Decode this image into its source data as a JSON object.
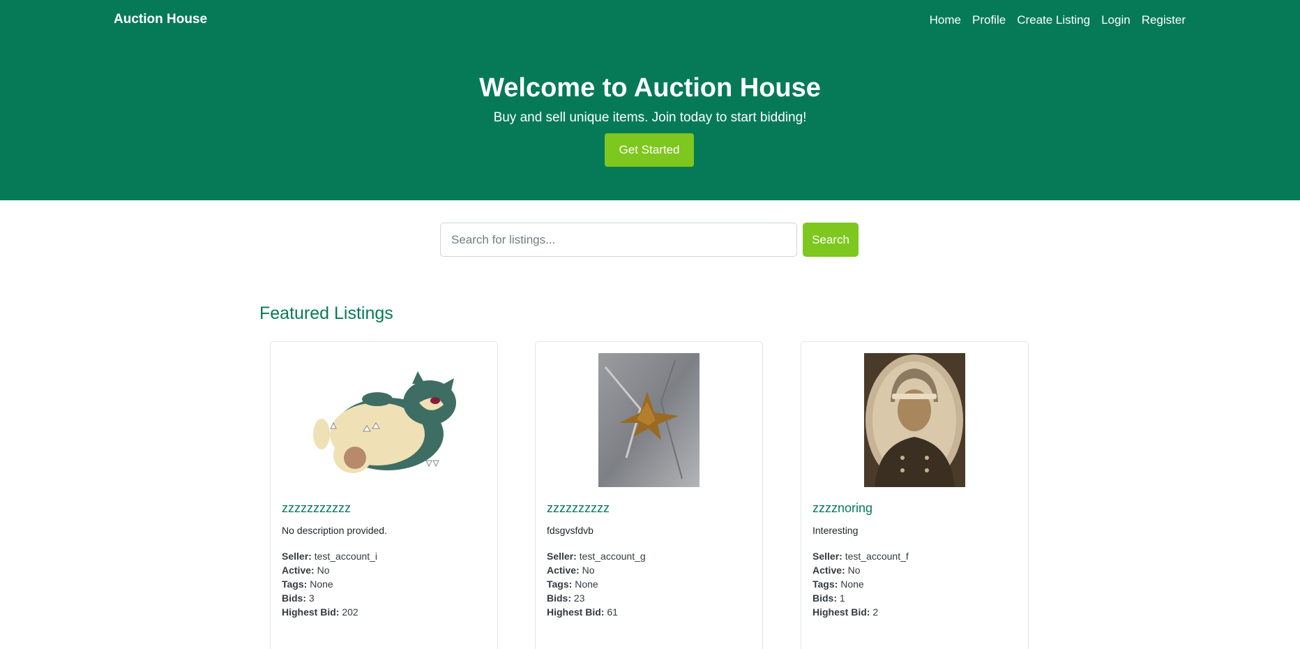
{
  "nav": {
    "brand": "Auction House",
    "links": [
      "Home",
      "Profile",
      "Create Listing",
      "Login",
      "Register"
    ]
  },
  "hero": {
    "title": "Welcome to Auction House",
    "subtitle": "Buy and sell unique items. Join today to start bidding!",
    "cta": "Get Started"
  },
  "search": {
    "placeholder": "Search for listings...",
    "button": "Search"
  },
  "section": {
    "title": "Featured Listings"
  },
  "labels": {
    "seller": "Seller:",
    "active": "Active:",
    "tags": "Tags:",
    "bids": "Bids:",
    "highest_bid": "Highest Bid:"
  },
  "listings": [
    {
      "title": "zzzzzzzzzzz",
      "description": "No description provided.",
      "seller": "test_account_i",
      "active": "No",
      "tags": "None",
      "bids": "3",
      "highest_bid": "202"
    },
    {
      "title": "zzzzzzzzzz",
      "description": "fdsgvsfdvb",
      "seller": "test_account_g",
      "active": "No",
      "tags": "None",
      "bids": "23",
      "highest_bid": "61"
    },
    {
      "title": "zzzznoring",
      "description": "Interesting",
      "seller": "test_account_f",
      "active": "No",
      "tags": "None",
      "bids": "1",
      "highest_bid": "2"
    }
  ],
  "colors": {
    "primary": "#067a57",
    "accent": "#7ec71e"
  }
}
